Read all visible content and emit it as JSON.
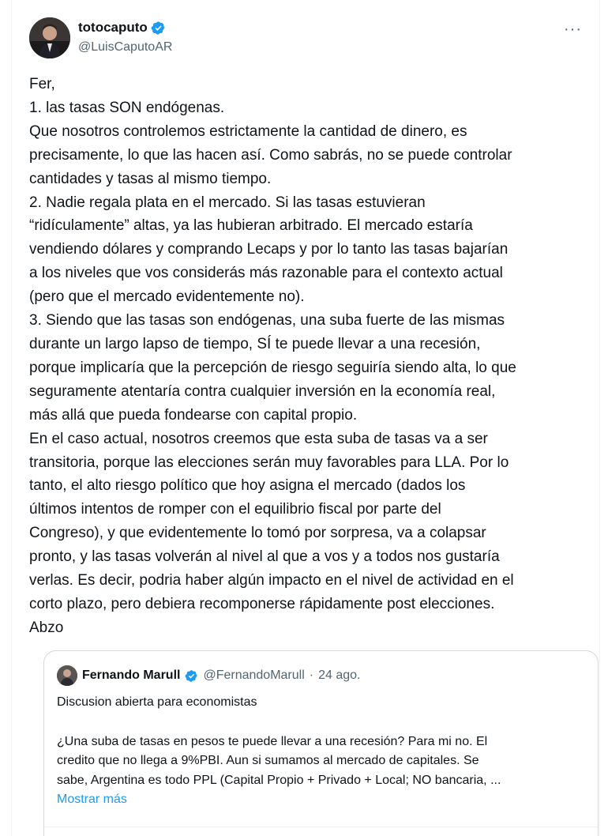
{
  "tweet": {
    "author": {
      "display_name": "totocaputo",
      "handle": "@LuisCaputoAR",
      "verified": true,
      "avatar_icon": "user-avatar"
    },
    "more_icon": "more-dots-icon",
    "more_label": "···",
    "lines": [
      "Fer,",
      "1. las tasas SON endógenas.",
      "Que nosotros controlemos estrictamente la cantidad de dinero, es",
      "precisamente, lo que las hacen así. Como sabrás, no se puede controlar",
      "cantidades y tasas al mismo tiempo.",
      "2. Nadie regala plata en el mercado. Si las tasas estuvieran",
      "“ridículamente” altas, ya las hubieran arbitrado. El mercado estaría",
      "vendiendo dólares y comprando Lecaps y por lo tanto las tasas bajarían",
      "a los niveles que vos considerás más razonable para el contexto actual",
      "(pero que el mercado evidentemente no).",
      "3. Siendo que las tasas son endógenas, una suba fuerte de las mismas",
      "durante un largo lapso de tiempo, SÍ te puede llevar a una recesión,",
      "porque implicaría que la percepción de riesgo seguiría siendo alta, lo que",
      "seguramente atentaría contra cualquier inversión en la economía real,",
      "más allá que pueda fondearse con capital propio.",
      "En el caso actual, nosotros creemos que esta suba de tasas va a ser",
      "transitoria, porque las elecciones serán muy favorables para LLA. Por lo",
      "tanto, el alto riesgo político que hoy asigna el mercado (dados los",
      "últimos intentos de romper con el equilibrio fiscal por parte del",
      "Congreso), y que evidentemente lo tomó por sorpresa, va a colapsar",
      "pronto, y las tasas volverán al nivel al que a vos y a todos nos gustaría",
      "verlas. Es decir, podria haber algún impacto en el nivel de actividad en el",
      "corto plazo, pero debiera recomponerse rápidamente post elecciones.",
      "Abzo"
    ]
  },
  "quote": {
    "display_name": "Fernando Marull",
    "handle": "@FernandoMarull",
    "separator": "·",
    "date": "24 ago.",
    "verified": true,
    "title_line": "Discusion abierta para economistas",
    "body_lines": [
      "¿Una suba de tasas en pesos te puede llevar a una recesión? Para mi no.  El",
      "credito que no llega a 9%PBI. Aun si sumamos al mercado de capitales. Se",
      "sabe, Argentina es todo PPL (Capital Propio + Privado + Local; NO bancaria, ..."
    ],
    "show_more": "Mostrar más"
  },
  "colors": {
    "text": "#0f1419",
    "secondary": "#536471",
    "accent": "#1d9bf0",
    "border": "#cfd9de"
  }
}
